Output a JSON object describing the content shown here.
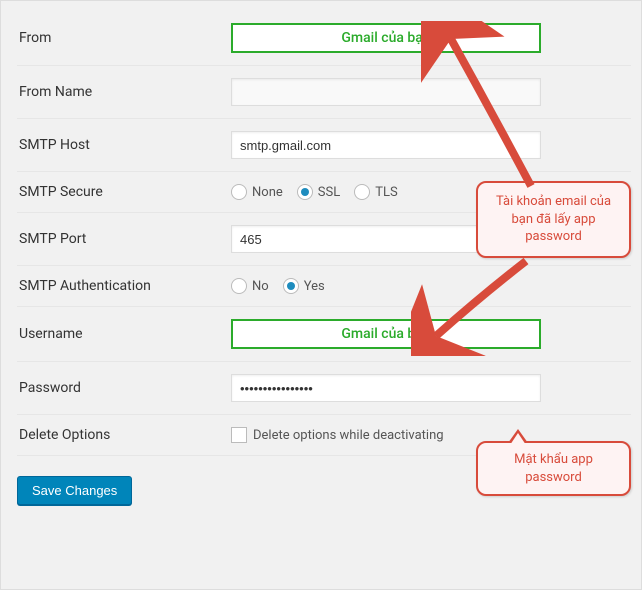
{
  "form": {
    "from": {
      "label": "From",
      "highlight_text": "Gmail của bạn"
    },
    "from_name": {
      "label": "From Name",
      "value": ""
    },
    "smtp_host": {
      "label": "SMTP Host",
      "value": "smtp.gmail.com"
    },
    "smtp_secure": {
      "label": "SMTP Secure",
      "options": [
        {
          "label": "None",
          "checked": false
        },
        {
          "label": "SSL",
          "checked": true
        },
        {
          "label": "TLS",
          "checked": false
        }
      ]
    },
    "smtp_port": {
      "label": "SMTP Port",
      "value": "465"
    },
    "smtp_auth": {
      "label": "SMTP Authentication",
      "options": [
        {
          "label": "No",
          "checked": false
        },
        {
          "label": "Yes",
          "checked": true
        }
      ]
    },
    "username": {
      "label": "Username",
      "highlight_text": "Gmail của bạn"
    },
    "password": {
      "label": "Password",
      "value": "••••••••••••••••"
    },
    "delete_options": {
      "label": "Delete Options",
      "checkbox_label": "Delete options while deactivating"
    },
    "save_button": "Save Changes"
  },
  "callouts": {
    "email_hint": "Tài khoản email của bạn đã lấy app password",
    "password_hint": "Mật khẩu app password"
  }
}
